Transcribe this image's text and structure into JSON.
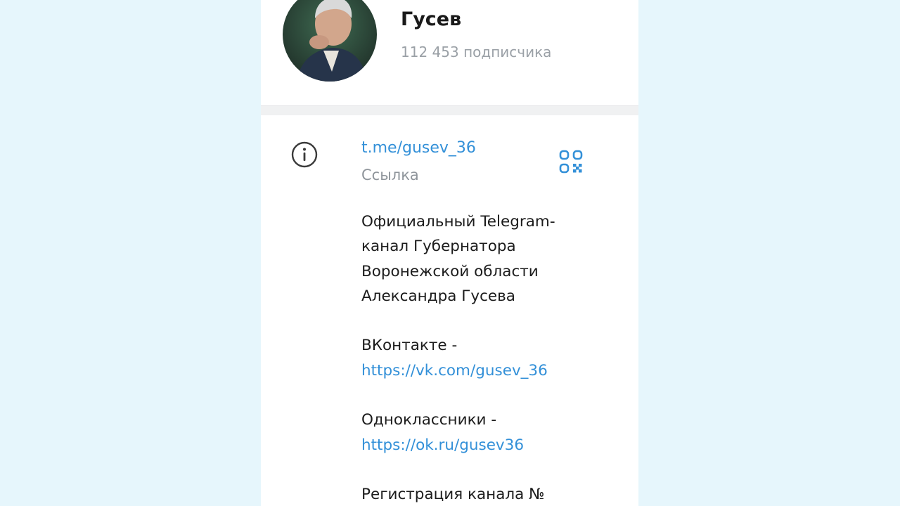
{
  "channel": {
    "name": "Гусев",
    "subscribers": "112 453 подписчика"
  },
  "info": {
    "link": "t.me/gusev_36",
    "link_caption": "Ссылка",
    "description": {
      "line1": "Официальный Telegram-",
      "line2": "канал Губернатора",
      "line3": "Воронежской области",
      "line4": "Александра Гусева",
      "vk_label": "ВКонтакте -",
      "vk_url": "https://vk.com/gusev_36",
      "ok_label": "Одноклассники -",
      "ok_url": "https://ok.ru/gusev36",
      "registration": "Регистрация канала №"
    }
  },
  "icons": {
    "info": "info-circle-icon",
    "qr": "qr-code-icon",
    "avatar": "channel-avatar-photo"
  },
  "colors": {
    "page_background": "#e6f6fc",
    "panel": "#ffffff",
    "link": "#3390d8",
    "secondary_text": "#9aa0a6"
  }
}
